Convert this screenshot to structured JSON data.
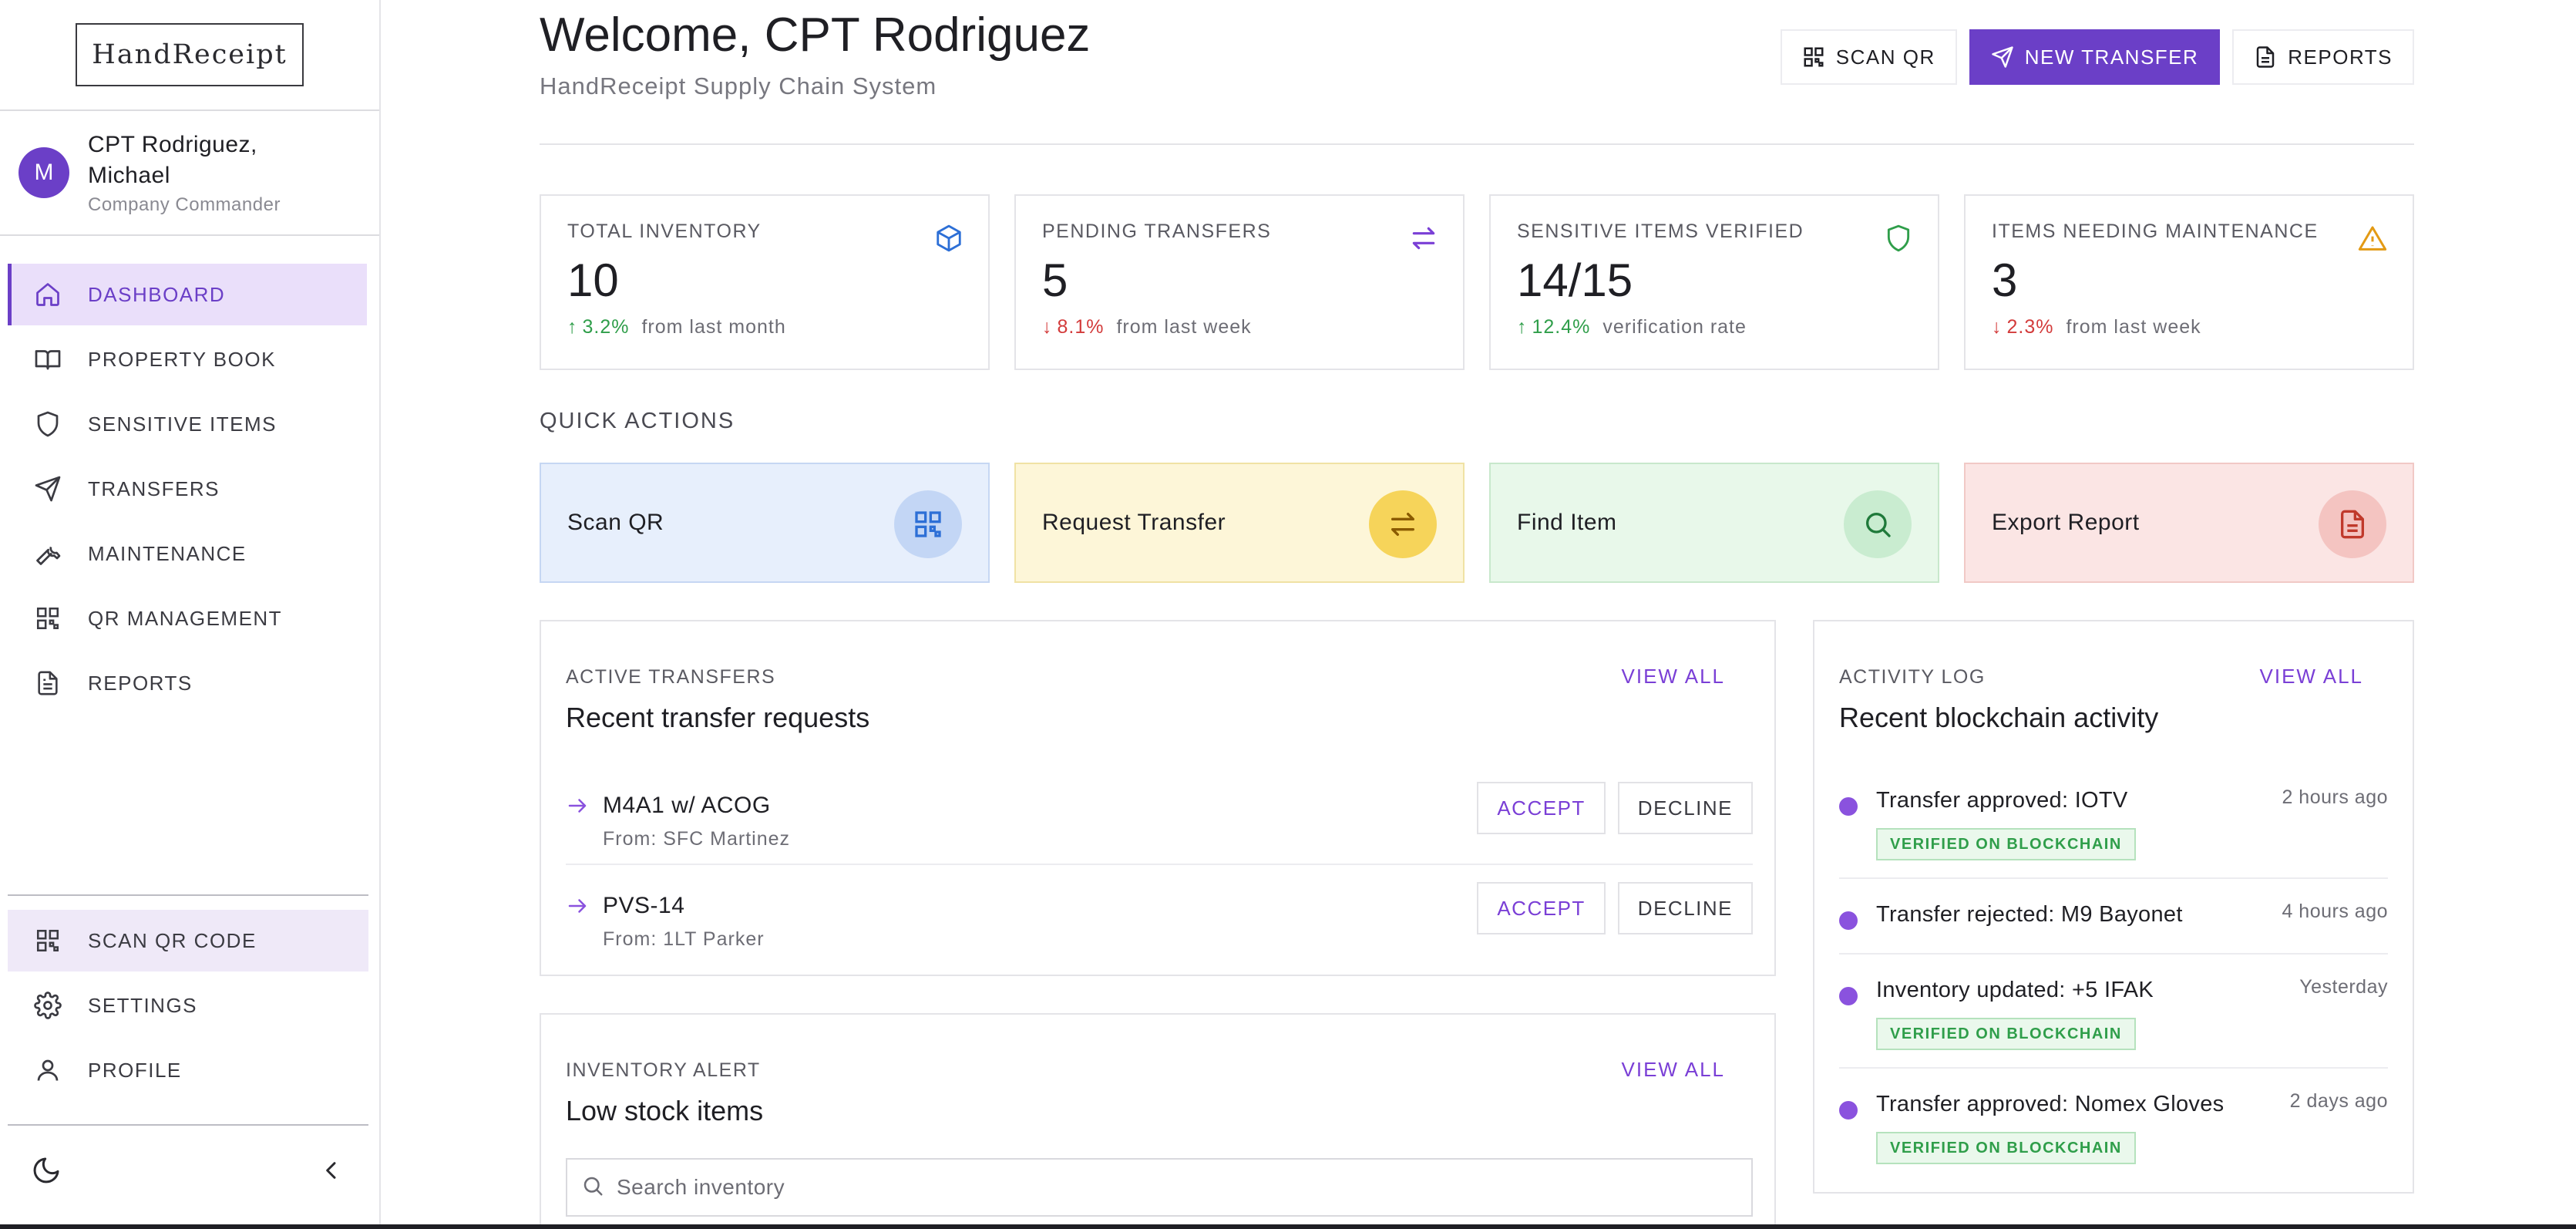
{
  "app": {
    "logo_text": "HandReceipt"
  },
  "user": {
    "initial": "M",
    "name": "CPT Rodriguez, Michael",
    "role": "Company Commander"
  },
  "sidebar": {
    "items": [
      {
        "label": "DASHBOARD",
        "icon": "home-icon"
      },
      {
        "label": "PROPERTY BOOK",
        "icon": "book-icon"
      },
      {
        "label": "SENSITIVE ITEMS",
        "icon": "shield-icon"
      },
      {
        "label": "TRANSFERS",
        "icon": "send-icon"
      },
      {
        "label": "MAINTENANCE",
        "icon": "wrench-icon"
      },
      {
        "label": "QR MANAGEMENT",
        "icon": "qr-icon"
      },
      {
        "label": "REPORTS",
        "icon": "document-icon"
      }
    ],
    "bottom_items": [
      {
        "label": "SCAN QR CODE",
        "icon": "qr-icon"
      },
      {
        "label": "SETTINGS",
        "icon": "gear-icon"
      },
      {
        "label": "PROFILE",
        "icon": "user-icon"
      }
    ]
  },
  "header": {
    "title": "Welcome, CPT Rodriguez",
    "subtitle": "HandReceipt Supply Chain System",
    "actions": {
      "scan_qr": "SCAN QR",
      "new_transfer": "NEW TRANSFER",
      "reports": "REPORTS"
    }
  },
  "stats": [
    {
      "label": "TOTAL INVENTORY",
      "value": "10",
      "trend": "3.2%",
      "trend_dir": "up",
      "trend_note": "from last month",
      "icon": "cube-icon"
    },
    {
      "label": "PENDING TRANSFERS",
      "value": "5",
      "trend": "8.1%",
      "trend_dir": "down",
      "trend_note": "from last week",
      "icon": "swap-icon"
    },
    {
      "label": "SENSITIVE ITEMS VERIFIED",
      "value": "14/15",
      "trend": "12.4%",
      "trend_dir": "up",
      "trend_note": "verification rate",
      "icon": "shield-check-icon"
    },
    {
      "label": "ITEMS NEEDING MAINTENANCE",
      "value": "3",
      "trend": "2.3%",
      "trend_dir": "down",
      "trend_note": "from last week",
      "icon": "warning-icon"
    }
  ],
  "quick_actions": {
    "title": "QUICK ACTIONS",
    "items": [
      {
        "label": "Scan QR",
        "icon": "qr-icon",
        "color": "#2d6fd6"
      },
      {
        "label": "Request Transfer",
        "icon": "swap-icon",
        "color": "#8a5a00"
      },
      {
        "label": "Find Item",
        "icon": "search-icon",
        "color": "#1f7a3a"
      },
      {
        "label": "Export Report",
        "icon": "document-icon",
        "color": "#c0392b"
      }
    ]
  },
  "active_transfers": {
    "kicker": "ACTIVE TRANSFERS",
    "heading": "Recent transfer requests",
    "view_all": "VIEW ALL",
    "rows": [
      {
        "name": "M4A1 w/ ACOG",
        "from": "From: SFC Martinez",
        "accept": "ACCEPT",
        "decline": "DECLINE"
      },
      {
        "name": "PVS-14",
        "from": "From: 1LT Parker",
        "accept": "ACCEPT",
        "decline": "DECLINE"
      }
    ]
  },
  "inventory_alert": {
    "kicker": "INVENTORY ALERT",
    "heading": "Low stock items",
    "view_all": "VIEW ALL",
    "search_placeholder": "Search inventory"
  },
  "activity_log": {
    "kicker": "ACTIVITY LOG",
    "heading": "Recent blockchain activity",
    "view_all": "VIEW ALL",
    "items": [
      {
        "text": "Transfer approved: IOTV",
        "time": "2 hours ago",
        "badge": "VERIFIED ON BLOCKCHAIN"
      },
      {
        "text": "Transfer rejected: M9 Bayonet",
        "time": "4 hours ago",
        "badge": ""
      },
      {
        "text": "Inventory updated: +5 IFAK",
        "time": "Yesterday",
        "badge": "VERIFIED ON BLOCKCHAIN"
      },
      {
        "text": "Transfer approved: Nomex Gloves",
        "time": "2 days ago",
        "badge": "VERIFIED ON BLOCKCHAIN"
      }
    ]
  },
  "colors": {
    "accent": "#6b3fc7",
    "trend_up": "#2f9e4a",
    "trend_down": "#d33b3b",
    "badge_green": "#2f9e4a"
  }
}
